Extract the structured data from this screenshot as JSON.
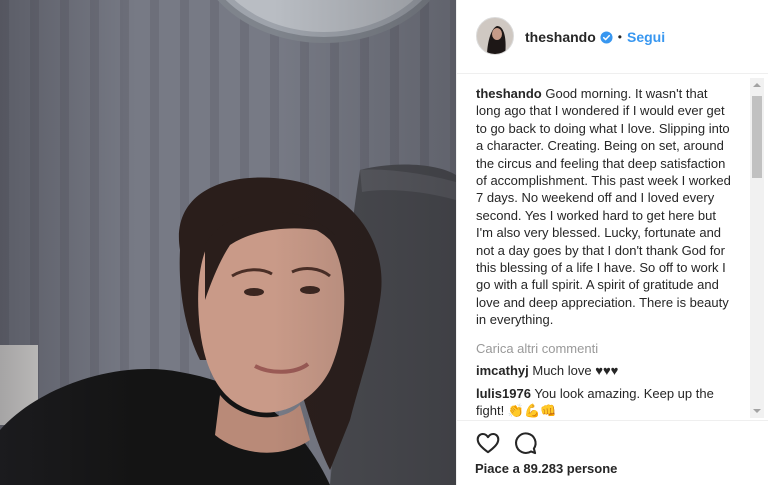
{
  "post": {
    "image_alt": "Selfie photo of a woman resting her head on a gray couch",
    "author": "theshando",
    "follow_label": "Segui",
    "separator": "•"
  },
  "caption": {
    "author": "theshando",
    "text": "Good morning. It wasn't that long ago that I wondered if I would ever get to go back to doing what I love. Slipping into a character. Creating. Being on set, around the circus and feeling that deep satisfaction of accomplishment. This past week I worked 7 days. No weekend off and I loved every second. Yes I worked hard to get here but I'm also very blessed. Lucky, fortunate and not a day goes by that I don't thank God for this blessing of a life I have. So off to work I go with a full spirit. A spirit of gratitude and love and deep appreciation. There is beauty in everything."
  },
  "load_more_label": "Carica altri commenti",
  "comments": [
    {
      "author": "imcathyj",
      "text": "Much love ♥♥♥"
    },
    {
      "author": "lulis1976",
      "text": "You look amazing. Keep up the fight! 👏💪👊"
    }
  ],
  "likes_label": "Piace a 89.283 persone",
  "icons": {
    "like": "heart-icon",
    "comment": "comment-icon",
    "verified": "verified-badge-icon"
  },
  "colors": {
    "link": "#3897f0",
    "text": "#262626",
    "muted": "#999999",
    "border": "#efefef"
  }
}
